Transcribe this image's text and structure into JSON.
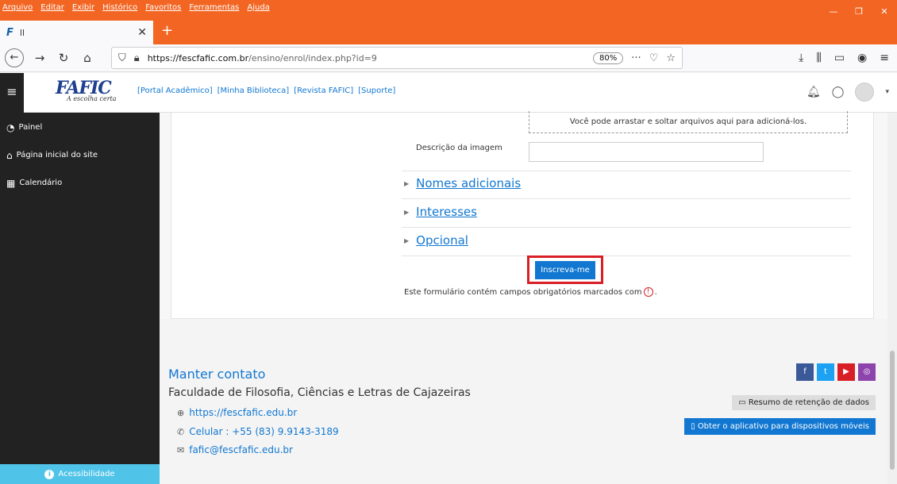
{
  "browser": {
    "menus": [
      "Arquivo",
      "Editar",
      "Exibir",
      "Histórico",
      "Favoritos",
      "Ferramentas",
      "Ajuda"
    ],
    "window_controls": [
      "—",
      "❐",
      "✕"
    ],
    "tab": {
      "logo": "F",
      "title": "ll",
      "close": "✕"
    },
    "new_tab": "+",
    "url_host": "https://fescfafic.com.br",
    "url_path": "/ensino/enrol/index.php?id=9",
    "zoom": "80%"
  },
  "header": {
    "logo_text": "FAFIC",
    "logo_tagline": "A escolha certa",
    "top_links": [
      "[Portal Acadêmico]",
      "[Minha Biblioteca]",
      "[Revista FAFIC]",
      "[Suporte]"
    ]
  },
  "sidebar": {
    "items": [
      {
        "label": "Painel",
        "icon": "dashboard-icon"
      },
      {
        "label": "Página inicial do site",
        "icon": "home-icon"
      },
      {
        "label": "Calendário",
        "icon": "calendar-icon"
      }
    ],
    "accessibility": "Acessibilidade"
  },
  "form": {
    "dropzone_text": "Você pode arrastar e soltar arquivos aqui para adicioná-los.",
    "image_description_label": "Descrição da imagem",
    "image_description_value": "",
    "sections": [
      "Nomes adicionais",
      "Interesses",
      "Opcional"
    ],
    "submit_label": "Inscreva-me",
    "required_note": "Este formulário contém campos obrigatórios marcados com",
    "required_note_end": "."
  },
  "footer": {
    "title": "Manter contato",
    "institution": "Faculdade de Filosofia, Ciências e Letras de Cajazeiras",
    "website": "https://fescfafic.edu.br",
    "phone": "Celular : +55 (83) 9.9143-3189",
    "email": "fafic@fescfafic.edu.br",
    "retention_label": "Resumo de retenção de dados",
    "mobile_app_label": "Obter o aplicativo para dispositivos móveis",
    "social_colors": {
      "facebook": "#3b5998",
      "twitter": "#1da1f2",
      "youtube": "#d81f26",
      "instagram": "#8e44ad"
    }
  },
  "colors": {
    "browser_accent": "#f26522",
    "link_blue": "#1177d1",
    "sidebar_bg": "#222222",
    "accessibility_bg": "#4fc3e8",
    "highlight_red": "#d81f26"
  }
}
